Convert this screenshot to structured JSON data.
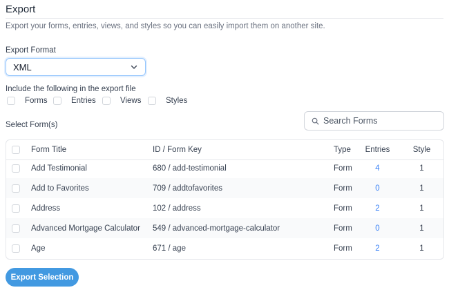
{
  "page": {
    "title": "Export",
    "description": "Export your forms, entries, views, and styles so you can easily import them on another site."
  },
  "format": {
    "label": "Export Format",
    "selected": "XML"
  },
  "include": {
    "label": "Include the following in the export file",
    "options": [
      "Forms",
      "Entries",
      "Views",
      "Styles"
    ]
  },
  "select_forms": {
    "label": "Select Form(s)",
    "search_placeholder": "Search Forms"
  },
  "table": {
    "headers": {
      "title": "Form Title",
      "key": "ID / Form Key",
      "type": "Type",
      "entries": "Entries",
      "style": "Style"
    },
    "rows": [
      {
        "title": "Add Testimonial",
        "key": "680 / add-testimonial",
        "type": "Form",
        "entries": "4",
        "style": "1"
      },
      {
        "title": "Add to Favorites",
        "key": "709 / addtofavorites",
        "type": "Form",
        "entries": "0",
        "style": "1"
      },
      {
        "title": "Address",
        "key": "102 / address",
        "type": "Form",
        "entries": "2",
        "style": "1"
      },
      {
        "title": "Advanced Mortgage Calculator",
        "key": "549 / advanced-mortgage-calculator",
        "type": "Form",
        "entries": "0",
        "style": "1"
      },
      {
        "title": "Age",
        "key": "671 / age",
        "type": "Form",
        "entries": "2",
        "style": "1"
      }
    ]
  },
  "actions": {
    "export_label": "Export Selection"
  },
  "colors": {
    "accent": "#4299e1",
    "link": "#3b82f6"
  }
}
